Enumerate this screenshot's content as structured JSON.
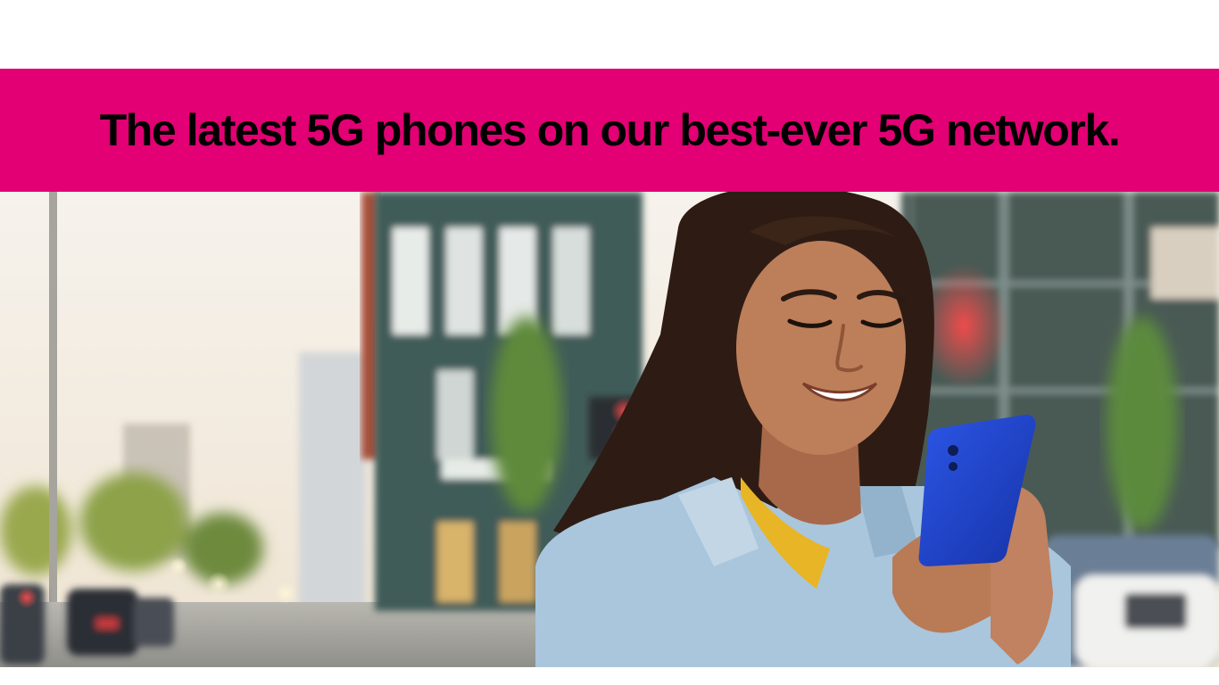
{
  "banner": {
    "headline": "The latest 5G phones on our best-ever 5G network.",
    "background_color": "#e20074",
    "text_color": "#000000"
  },
  "hero": {
    "colors": {
      "sky": "#f2ece2",
      "building_teal": "#3f5a57",
      "jacket": "#a9c6dd",
      "shirt": "#e8b526",
      "phone": "#1e40c8",
      "skin": "#b97a56",
      "hair": "#2e1c14"
    }
  }
}
